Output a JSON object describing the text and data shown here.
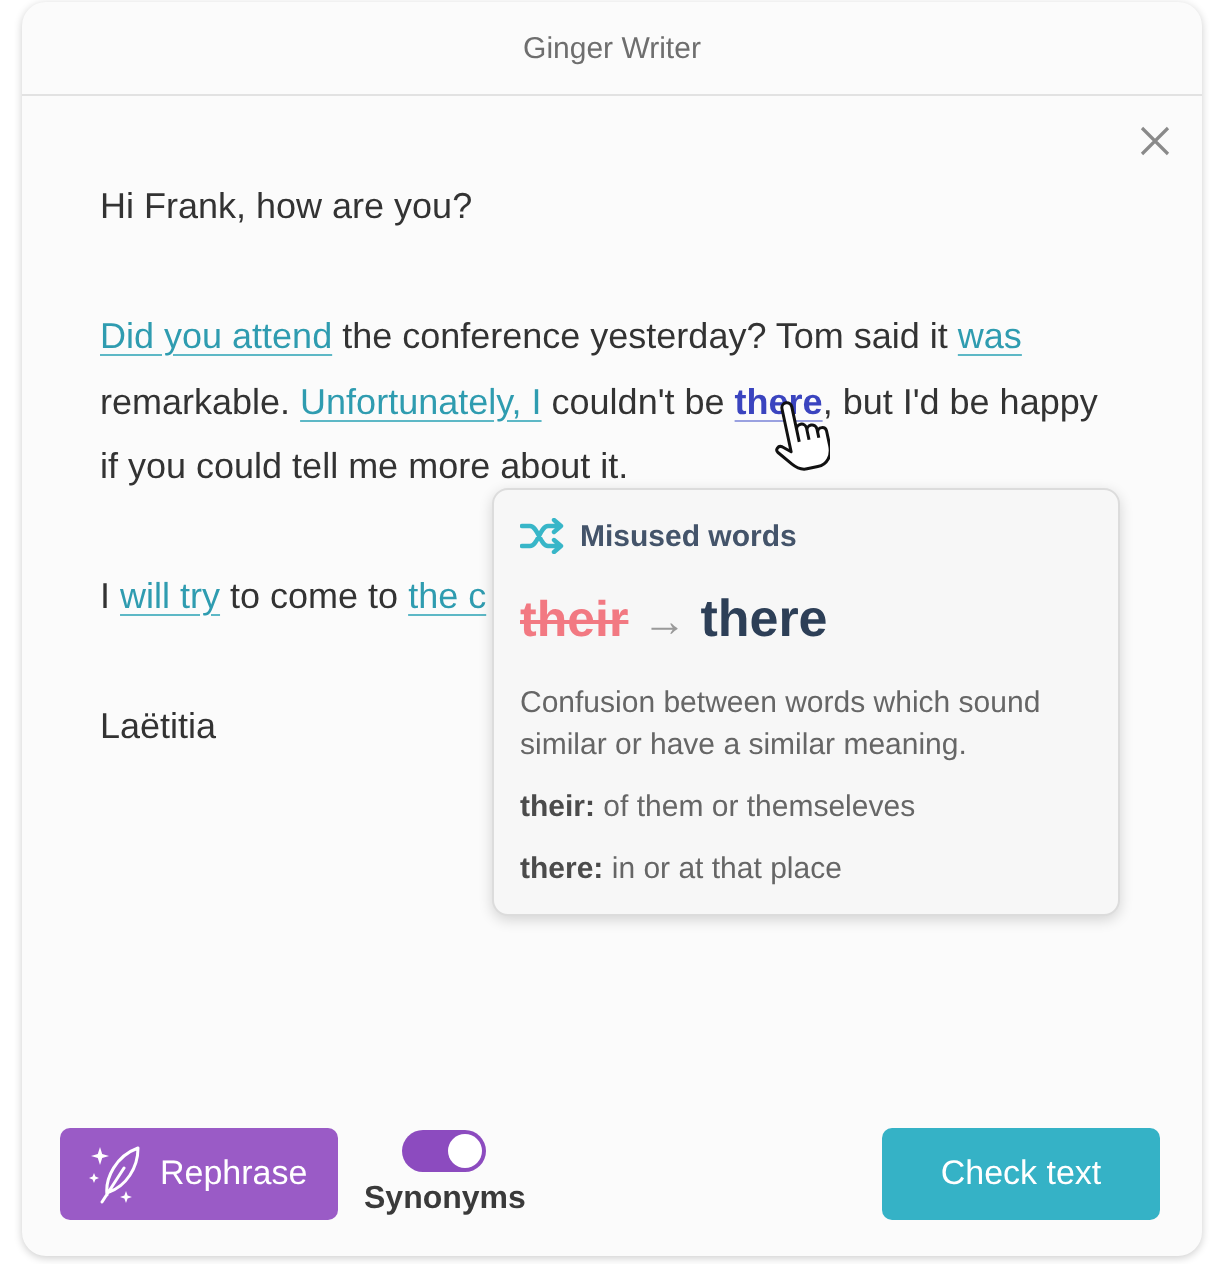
{
  "window": {
    "title": "Ginger Writer"
  },
  "document": {
    "paragraphs": [
      {
        "lines": [
          [
            {
              "kind": "text",
              "text": "Hi Frank, how are you?"
            }
          ]
        ]
      },
      {
        "lines": [
          [
            {
              "kind": "suggestion",
              "text": "Did you attend",
              "selected": false
            },
            {
              "kind": "text",
              "text": " the conference yesterday? Tom said it "
            },
            {
              "kind": "suggestion",
              "text": "was",
              "selected": false
            }
          ],
          [
            {
              "kind": "text",
              "text": "remarkable. "
            },
            {
              "kind": "suggestion",
              "text": "Unfortunately, I",
              "selected": false
            },
            {
              "kind": "text",
              "text": " couldn't be "
            },
            {
              "kind": "suggestion",
              "text": "there",
              "selected": true
            },
            {
              "kind": "text",
              "text": ", but I'd be happy"
            }
          ],
          [
            {
              "kind": "text",
              "text": "if you could tell me more about it."
            }
          ]
        ]
      },
      {
        "lines": [
          [
            {
              "kind": "text",
              "text": "I "
            },
            {
              "kind": "suggestion",
              "text": "will try",
              "selected": false
            },
            {
              "kind": "text",
              "text": " to come to "
            },
            {
              "kind": "suggestion",
              "text": "the c",
              "selected": false
            }
          ]
        ]
      },
      {
        "lines": [
          [
            {
              "kind": "text",
              "text": "Laëtitia"
            }
          ]
        ]
      }
    ]
  },
  "popup": {
    "category": "Misused words",
    "original": "their",
    "arrow": "→",
    "replacement": "there",
    "description": "Confusion between words which sound similar or have a similar meaning.",
    "definitions": [
      "**their:** of them or themseleves",
      "**there:** in or at that place"
    ]
  },
  "footer": {
    "rephrase": {
      "label": "Rephrase"
    },
    "synonyms": {
      "label": "Synonyms",
      "on": true
    },
    "check": {
      "label": "Check text"
    }
  }
}
